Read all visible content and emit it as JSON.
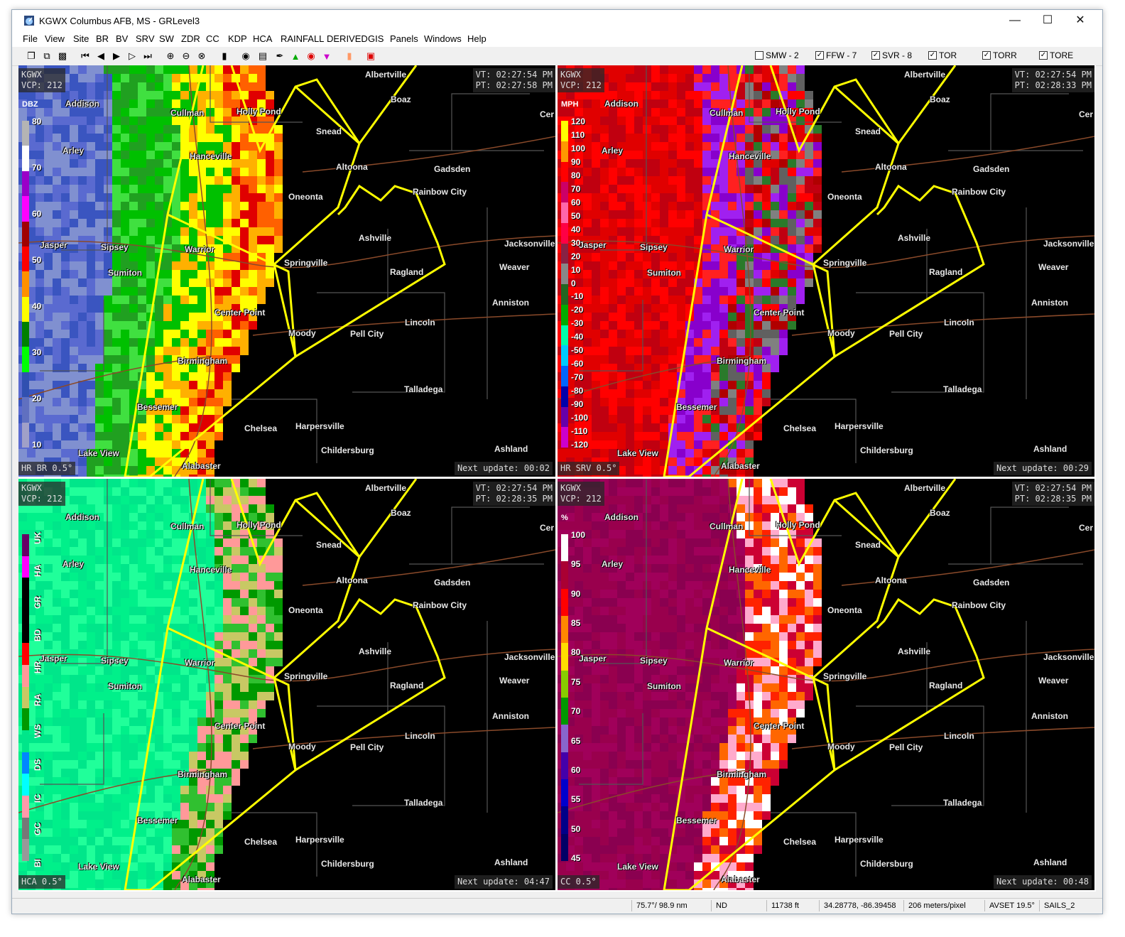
{
  "window": {
    "title": "KGWX Columbus AFB, MS - GRLevel3"
  },
  "menu": [
    "File",
    "View",
    "Site",
    "BR",
    "BV",
    "SRV",
    "SW",
    "ZDR",
    "CC",
    "KDP",
    "HCA",
    "RAINFALL",
    "DERIVED",
    "GIS",
    "Panels",
    "Windows",
    "Help"
  ],
  "toolbar": {
    "icons": [
      "copy-icon",
      "copy2-icon",
      "palette-icon",
      "first-frame-icon",
      "step-back-icon",
      "play-icon",
      "step-forward-icon",
      "last-frame-icon",
      "zoom-in-icon",
      "zoom-out-icon",
      "zoom-reset-icon",
      "cursor-icon",
      "radar-icon",
      "colorbar-icon",
      "pin-icon",
      "triangle-icon",
      "circle-icon",
      "down-triangle-icon",
      "orange-box-icon",
      "stop-icon"
    ],
    "checks": [
      {
        "label": "SMW - 2",
        "checked": false
      },
      {
        "label": "FFW - 7",
        "checked": true
      },
      {
        "label": "SVR - 8",
        "checked": true
      },
      {
        "label": "TOR",
        "checked": true
      },
      {
        "label": "TORR",
        "checked": true
      },
      {
        "label": "TORE",
        "checked": true
      }
    ]
  },
  "cities": [
    "Albertville",
    "Boaz",
    "Addison",
    "Cullman",
    "Holly Pond",
    "Snead",
    "Arley",
    "Hanceville",
    "Altoona",
    "Gadsden",
    "Oneonta",
    "Rainbow City",
    "Ashville",
    "Jacksonville",
    "Jasper",
    "Sipsey",
    "Warrior",
    "Springville",
    "Weaver",
    "Sumiton",
    "Ragland",
    "Anniston",
    "Center Point",
    "Lincoln",
    "Moody",
    "Pell City",
    "Birmingham",
    "Talladega",
    "Bessemer",
    "Chelsea",
    "Harpersville",
    "Childersburg",
    "Lake View",
    "Alabaster",
    "Ashland",
    "Cer"
  ],
  "panels": [
    {
      "site": "KGWX",
      "vcp": "VCP: 212",
      "vt": "VT: 02:27:54 PM",
      "pt": "PT: 02:27:58 PM",
      "product": "HR BR 0.5°",
      "next": "Next update: 00:02",
      "unit": "DBZ",
      "legend": [
        "80",
        "70",
        "60",
        "50",
        "40",
        "30",
        "20",
        "10"
      ],
      "colors": [
        "#b4b4b4",
        "#ffffff",
        "#9a00c8",
        "#ff00ff",
        "#a00000",
        "#ff0000",
        "#ff9000",
        "#ffff00",
        "#008000",
        "#00ff00",
        "#3050b0",
        "#6070c0",
        "#a0a0c8"
      ]
    },
    {
      "site": "KGWX",
      "vcp": "VCP: 212",
      "vt": "VT: 02:27:54 PM",
      "pt": "PT: 02:28:33 PM",
      "product": "HR SRV 0.5°",
      "next": "Next update: 00:29",
      "unit": "MPH",
      "legend": [
        "120",
        "110",
        "100",
        "90",
        "80",
        "70",
        "60",
        "50",
        "40",
        "30",
        "20",
        "10",
        "0",
        "-10",
        "-20",
        "-30",
        "-40",
        "-50",
        "-60",
        "-70",
        "-80",
        "-90",
        "-100",
        "-110",
        "-120"
      ],
      "colors": [
        "#ffff00",
        "#ff9900",
        "#ff0000",
        "#cc0066",
        "#ff66aa",
        "#ff0044",
        "#882244",
        "#888888",
        "#226622",
        "#00aa00",
        "#00ffaa",
        "#00ccff",
        "#0066ff",
        "#0000aa",
        "#6600aa",
        "#cc00cc"
      ]
    },
    {
      "site": "KGWX",
      "vcp": "VCP: 212",
      "vt": "VT: 02:27:54 PM",
      "pt": "PT: 02:28:35 PM",
      "product": "HCA 0.5°",
      "next": "Next update: 04:47",
      "unit": "",
      "legend": [
        "UK",
        "HA",
        "GR",
        "BD",
        "HR",
        "RA",
        "WS",
        "DS",
        "IC",
        "GC",
        "BI"
      ],
      "colors": [
        "#660066",
        "#ff00ff",
        "#000000",
        "#000000",
        "#000000",
        "#ff0000",
        "#ff9999",
        "#c8c864",
        "#009900",
        "#00e68a",
        "#0088ff",
        "#00ffff",
        "#ff99aa",
        "#777777",
        "#999999"
      ]
    },
    {
      "site": "KGWX",
      "vcp": "VCP: 212",
      "vt": "VT: 02:27:54 PM",
      "pt": "PT: 02:28:35 PM",
      "product": "CC 0.5°",
      "next": "Next update: 00:48",
      "unit": "%",
      "legend": [
        "100",
        "95",
        "90",
        "85",
        "80",
        "75",
        "70",
        "65",
        "60",
        "55",
        "50",
        "45"
      ],
      "colors": [
        "#ffffff",
        "#aa0033",
        "#ff0000",
        "#ff8800",
        "#ffdd00",
        "#88cc00",
        "#009900",
        "#8866cc",
        "#4400aa",
        "#0000cc",
        "#000088",
        "#000066"
      ]
    }
  ],
  "status": [
    "75.7°/ 98.9 nm",
    "ND",
    "11738 ft",
    "34.28778, -86.39458",
    "206 meters/pixel",
    "AVSET 19.5°",
    "SAILS_2"
  ]
}
